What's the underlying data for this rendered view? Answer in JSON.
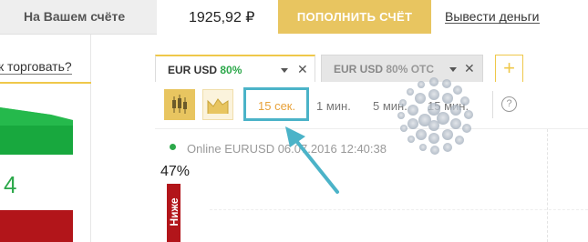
{
  "header": {
    "balance_label": "На Вашем счёте",
    "balance_amount": "1925,92 ₽",
    "deposit_label": "ПОПОЛНИТЬ СЧЁТ",
    "withdraw_label": "Вывести деньги"
  },
  "sidebar": {
    "how_to_trade": "к торговать?",
    "number": "4"
  },
  "tabs": [
    {
      "symbol": "EUR USD",
      "percent": "80%",
      "state": "active"
    },
    {
      "symbol": "EUR USD",
      "percent": "80% OTC",
      "state": "inactive"
    }
  ],
  "add_tab_label": "+",
  "toolbar": {
    "chart_types": [
      "candles-icon",
      "area-chart-icon"
    ],
    "timeframes": [
      {
        "label": "15 сек.",
        "selected": true
      },
      {
        "label": "1 мин.",
        "selected": false
      },
      {
        "label": "5 мин.",
        "selected": false
      },
      {
        "label": "15 мин.",
        "selected": false
      }
    ],
    "help_label": "?"
  },
  "chart": {
    "status_text": "Online EURUSD 06.07.2016 12:40:38",
    "percent": "47%",
    "down_label": "Ниже"
  },
  "colors": {
    "accent": "#e8c560",
    "up": "#2ca84a",
    "down": "#b2151a",
    "annotation": "#4bb3c8"
  }
}
